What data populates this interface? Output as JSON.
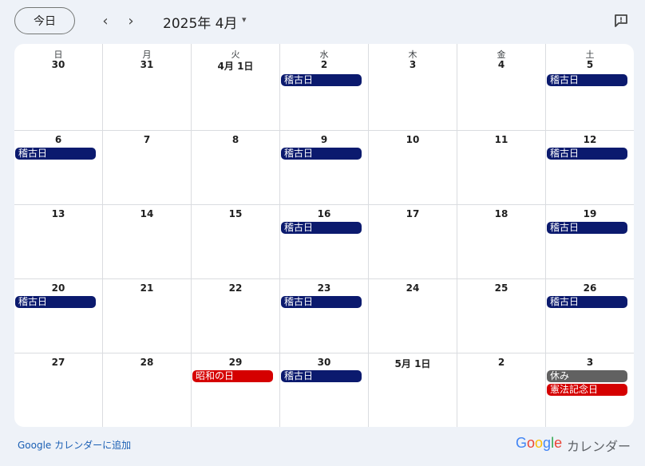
{
  "toolbar": {
    "today_label": "今日",
    "prev_icon": "‹",
    "next_icon": "›",
    "month_title": "2025年 4月",
    "caret_icon": "▾"
  },
  "weekdays": [
    "日",
    "月",
    "火",
    "水",
    "木",
    "金",
    "土"
  ],
  "weeks": [
    {
      "dates": [
        "30",
        "31",
        "4月 1日",
        "2",
        "3",
        "4",
        "5"
      ]
    },
    {
      "dates": [
        "6",
        "7",
        "8",
        "9",
        "10",
        "11",
        "12"
      ]
    },
    {
      "dates": [
        "13",
        "14",
        "15",
        "16",
        "17",
        "18",
        "19"
      ]
    },
    {
      "dates": [
        "20",
        "21",
        "22",
        "23",
        "24",
        "25",
        "26"
      ]
    },
    {
      "dates": [
        "27",
        "28",
        "29",
        "30",
        "5月 1日",
        "2",
        "3"
      ]
    }
  ],
  "events": [
    {
      "week": 0,
      "day": 3,
      "slot": 0,
      "label": "稽古日",
      "color": "#0b1a6e"
    },
    {
      "week": 0,
      "day": 6,
      "slot": 0,
      "label": "稽古日",
      "color": "#0b1a6e"
    },
    {
      "week": 1,
      "day": 0,
      "slot": 0,
      "label": "稽古日",
      "color": "#0b1a6e"
    },
    {
      "week": 1,
      "day": 3,
      "slot": 0,
      "label": "稽古日",
      "color": "#0b1a6e"
    },
    {
      "week": 1,
      "day": 6,
      "slot": 0,
      "label": "稽古日",
      "color": "#0b1a6e"
    },
    {
      "week": 2,
      "day": 3,
      "slot": 0,
      "label": "稽古日",
      "color": "#0b1a6e"
    },
    {
      "week": 2,
      "day": 6,
      "slot": 0,
      "label": "稽古日",
      "color": "#0b1a6e"
    },
    {
      "week": 3,
      "day": 0,
      "slot": 0,
      "label": "稽古日",
      "color": "#0b1a6e"
    },
    {
      "week": 3,
      "day": 3,
      "slot": 0,
      "label": "稽古日",
      "color": "#0b1a6e"
    },
    {
      "week": 3,
      "day": 6,
      "slot": 0,
      "label": "稽古日",
      "color": "#0b1a6e"
    },
    {
      "week": 4,
      "day": 2,
      "slot": 0,
      "label": "昭和の日",
      "color": "#d50000"
    },
    {
      "week": 4,
      "day": 3,
      "slot": 0,
      "label": "稽古日",
      "color": "#0b1a6e"
    },
    {
      "week": 4,
      "day": 6,
      "slot": 0,
      "label": "休み",
      "color": "#616161"
    },
    {
      "week": 4,
      "day": 6,
      "slot": 1,
      "label": "憲法記念日",
      "color": "#d50000"
    }
  ],
  "footer": {
    "add_link": "Google カレンダーに追加",
    "logo_letters": [
      "G",
      "o",
      "o",
      "g",
      "l",
      "e"
    ],
    "logo_word": "カレンダー"
  }
}
